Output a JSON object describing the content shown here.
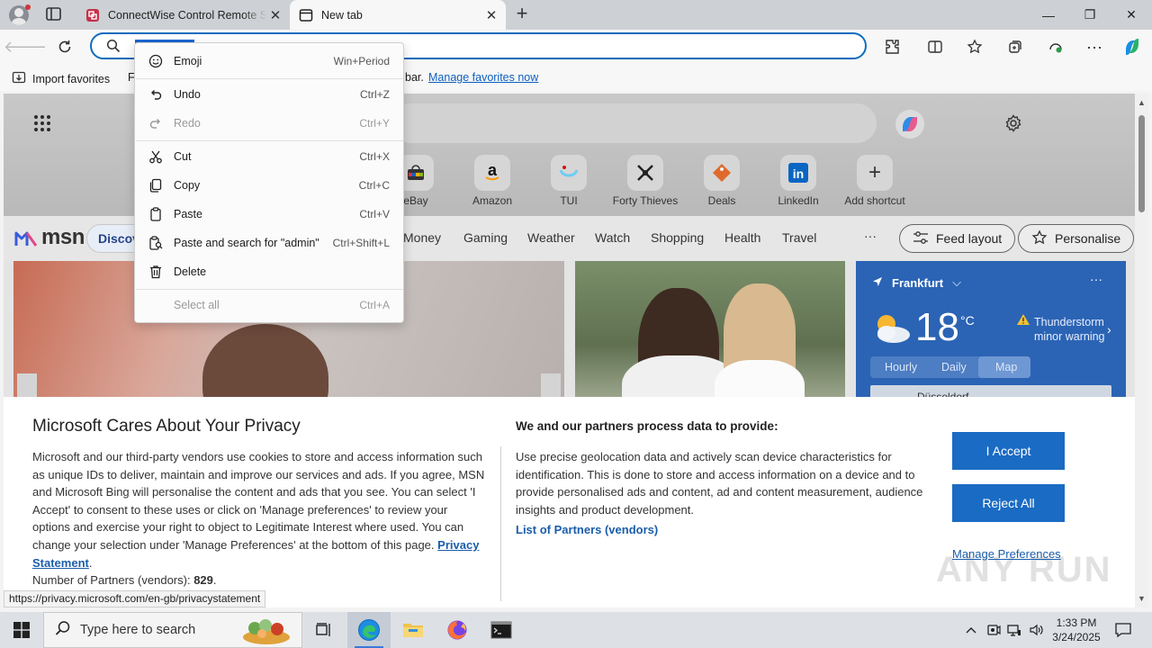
{
  "browser": {
    "tabs": [
      {
        "title": "ConnectWise Control Remote Su"
      },
      {
        "title": "New tab"
      }
    ],
    "new_tab_label": "+",
    "window_controls": {
      "minimize": "—",
      "restore": "❐",
      "close": "✕"
    },
    "address": {
      "value": "admin",
      "placeholder": ""
    }
  },
  "favorites_bar": {
    "import_label": "Import favorites",
    "partial_letter": "F",
    "bar_text": "bar.",
    "manage_link": "Manage favorites now"
  },
  "context_menu": {
    "items": [
      {
        "label": "Emoji",
        "shortcut": "Win+Period",
        "icon": "emoji-icon",
        "enabled": true
      },
      {
        "label": "Undo",
        "shortcut": "Ctrl+Z",
        "icon": "undo-icon",
        "enabled": true
      },
      {
        "label": "Redo",
        "shortcut": "Ctrl+Y",
        "icon": "redo-icon",
        "enabled": false
      },
      {
        "label": "Cut",
        "shortcut": "Ctrl+X",
        "icon": "cut-icon",
        "enabled": true
      },
      {
        "label": "Copy",
        "shortcut": "Ctrl+C",
        "icon": "copy-icon",
        "enabled": true
      },
      {
        "label": "Paste",
        "shortcut": "Ctrl+V",
        "icon": "paste-icon",
        "enabled": true
      },
      {
        "label": "Paste and search for \"admin\"",
        "shortcut": "Ctrl+Shift+L",
        "icon": "paste-search-icon",
        "enabled": true
      },
      {
        "label": "Delete",
        "shortcut": "",
        "icon": "delete-icon",
        "enabled": true
      },
      {
        "label": "Select all",
        "shortcut": "Ctrl+A",
        "icon": "",
        "enabled": false
      }
    ]
  },
  "newtab_page": {
    "shortcuts": [
      {
        "label": "eBay"
      },
      {
        "label": "Amazon"
      },
      {
        "label": "TUI"
      },
      {
        "label": "Forty Thieves"
      },
      {
        "label": "Deals"
      },
      {
        "label": "LinkedIn"
      },
      {
        "label": "Add shortcut"
      }
    ],
    "msn": {
      "logo_text": "msn",
      "discover_label": "Discov",
      "categories": [
        "Money",
        "Gaming",
        "Weather",
        "Watch",
        "Shopping",
        "Health",
        "Travel"
      ],
      "more_label": "···",
      "feed_layout_label": "Feed layout",
      "personalise_label": "Personalise"
    },
    "weather": {
      "location": "Frankfurt",
      "temperature": "18",
      "unit": "°C",
      "warning": "Thunderstorm minor warning",
      "tabs": [
        "Hourly",
        "Daily",
        "Map"
      ],
      "active_tab": "Map",
      "map_label": "Düsseldorf"
    }
  },
  "privacy_banner": {
    "title": "Microsoft Cares About Your Privacy",
    "description": "Microsoft and our third-party vendors use cookies to store and access information such as unique IDs to deliver, maintain and improve our services and ads. If you agree, MSN and Microsoft Bing will personalise the content and ads that you see. You can select 'I Accept' to consent to these uses or click on 'Manage preferences' to review your options and exercise your right to object to Legitimate Interest where used.  You can change your selection under 'Manage Preferences' at the bottom of this page.",
    "privacy_link": "Privacy Statement",
    "partners_label": "Number of Partners (vendors):",
    "partners_count": "829",
    "process_title": "We and our partners process data to provide:",
    "process_text": "Use precise geolocation data and actively scan device characteristics for identification. This is done to store and access information on a device and to provide personalised ads and content, ad and content measurement, audience insights and product development.",
    "partners_link": "List of Partners (vendors)",
    "accept_label": "I Accept",
    "reject_label": "Reject All",
    "manage_label": "Manage Preferences"
  },
  "status_url": "https://privacy.microsoft.com/en-gb/privacystatement",
  "watermark": "ANY RUN",
  "taskbar": {
    "search_placeholder": "Type here to search",
    "time": "1:33 PM",
    "date": "3/24/2025"
  },
  "colors": {
    "accent": "#0f6cbd",
    "privacy_button": "#1a6bc3",
    "weather_card": "#2b64b5",
    "taskbar": "#dde1e6"
  }
}
